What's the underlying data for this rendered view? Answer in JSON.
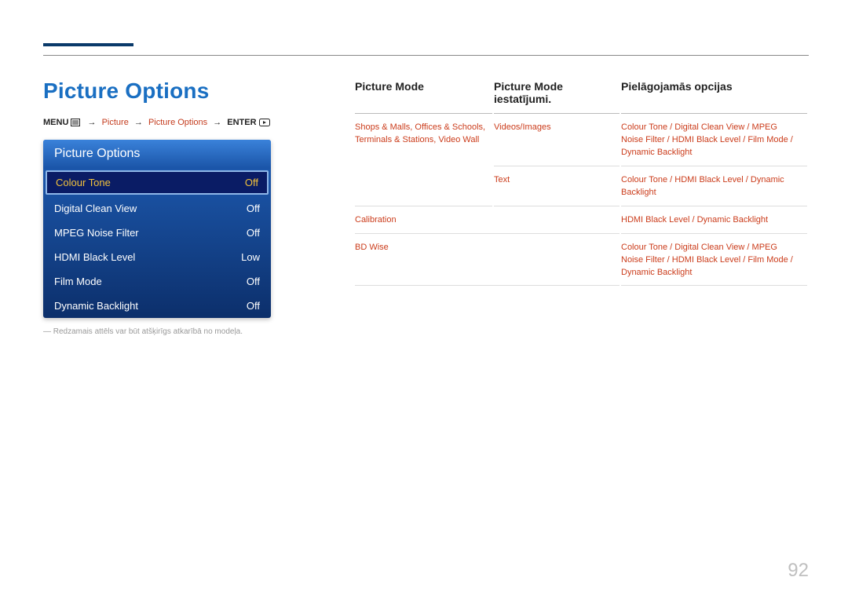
{
  "page": {
    "title": "Picture Options",
    "page_number": "92",
    "footnote": "―  Redzamais attēls var būt atšķirīgs atkarībā no modeļa."
  },
  "breadcrumb": {
    "menu": "MENU",
    "steps": [
      "Picture",
      "Picture Options"
    ],
    "enter": "ENTER",
    "arrow": "→"
  },
  "menu_panel": {
    "header": "Picture Options",
    "rows": [
      {
        "label": "Colour Tone",
        "value": "Off",
        "selected": true
      },
      {
        "label": "Digital Clean View",
        "value": "Off",
        "selected": false
      },
      {
        "label": "MPEG Noise Filter",
        "value": "Off",
        "selected": false
      },
      {
        "label": "HDMI Black Level",
        "value": "Low",
        "selected": false
      },
      {
        "label": "Film Mode",
        "value": "Off",
        "selected": false
      },
      {
        "label": "Dynamic Backlight",
        "value": "Off",
        "selected": false
      }
    ]
  },
  "table": {
    "headers": [
      "Picture Mode",
      "Picture Mode iestatījumi.",
      "Pielāgojamās opcijas"
    ],
    "rows": [
      {
        "mode": "Shops & Malls, Offices & Schools, Terminals & Stations, Video Wall",
        "setting": "Videos/Images",
        "options": [
          "Colour Tone",
          "Digital Clean View",
          "MPEG Noise Filter",
          "HDMI Black Level",
          "Film Mode",
          "Dynamic Backlight"
        ]
      },
      {
        "mode": "",
        "setting": "Text",
        "options": [
          "Colour Tone",
          "HDMI Black Level",
          "Dynamic Backlight"
        ]
      },
      {
        "mode": "Calibration",
        "setting": "",
        "options": [
          "HDMI Black Level",
          "Dynamic Backlight"
        ]
      },
      {
        "mode": "BD Wise",
        "setting": "",
        "options": [
          "Colour Tone",
          "Digital Clean View",
          "MPEG Noise Filter",
          "HDMI Black Level",
          "Film Mode",
          "Dynamic Backlight"
        ]
      }
    ],
    "option_sep": " / "
  }
}
